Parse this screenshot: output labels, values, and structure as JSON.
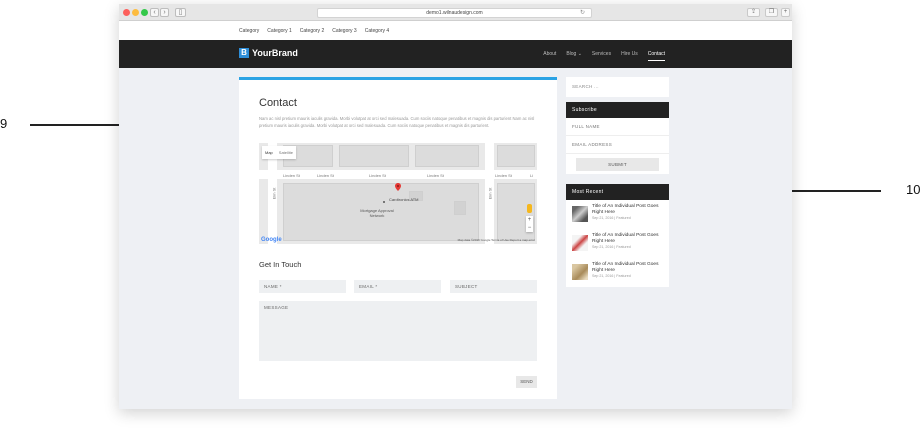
{
  "callouts": [
    {
      "number": "9"
    },
    {
      "number": "10"
    }
  ],
  "browser": {
    "url": "demo1.wilnaudesign.com"
  },
  "topbar": {
    "categories": [
      "Category",
      "Category 1",
      "Category 2",
      "Category 3",
      "Category 4"
    ]
  },
  "header": {
    "brand_mark": "B",
    "brand_name": "YourBrand",
    "nav": [
      "About",
      "Blog ⌄",
      "Services",
      "Hire Us",
      "Contact"
    ]
  },
  "contact": {
    "title": "Contact",
    "lede": "Nam ac nisl pretium mauris iaculis gravida. Morbi volutpat at orci sed malesuada. Cum sociis natoque penatibus et magnis dis parturient Nam ac nisl pretium mauris iaculis gravida. Morbi volutpat at orci sed malesuada. Cum sociis natoque penatibus et magnis dis parturient.",
    "map": {
      "tab_map": "Map",
      "tab_satellite": "Satellite",
      "streets": [
        "Linden St",
        "Linden St",
        "Linden St",
        "Linden St",
        "Linden St",
        "Li"
      ],
      "vertical_streets": [
        "Elm St",
        "Elm St"
      ],
      "pin_label": "Cardtronics ATM",
      "poi_label": "Mortgage Approval Network",
      "google": "Google",
      "credit": "Map data ©2016 Google   Terms of Use   Report a map error",
      "zoom_in": "+",
      "zoom_out": "−"
    },
    "form": {
      "heading": "Get In Touch",
      "name_placeholder": "NAME *",
      "email_placeholder": "EMAIL *",
      "subject_placeholder": "SUBJECT",
      "message_placeholder": "MESSAGE",
      "send_label": "SEND"
    }
  },
  "sidebar": {
    "search_placeholder": "SEARCH ...",
    "subscribe": {
      "heading": "Subscribe",
      "full_name": "FULL NAME",
      "email": "EMAIL ADDRESS",
      "submit": "SUBMIT"
    },
    "recent": {
      "heading": "Most Recent",
      "posts": [
        {
          "title": "Title of An Individual Post Goes Right Here",
          "meta": "Sep 21, 2016 | Featured"
        },
        {
          "title": "Title of An Individual Post Goes Right Here",
          "meta": "Sep 21, 2016 | Featured"
        },
        {
          "title": "Title of An Individual Post Goes Right Here",
          "meta": "Sep 21, 2016 | Featured"
        }
      ]
    }
  },
  "colors": {
    "accent": "#2ba3e4",
    "header": "#222222",
    "page_bg": "#eef0f4"
  }
}
